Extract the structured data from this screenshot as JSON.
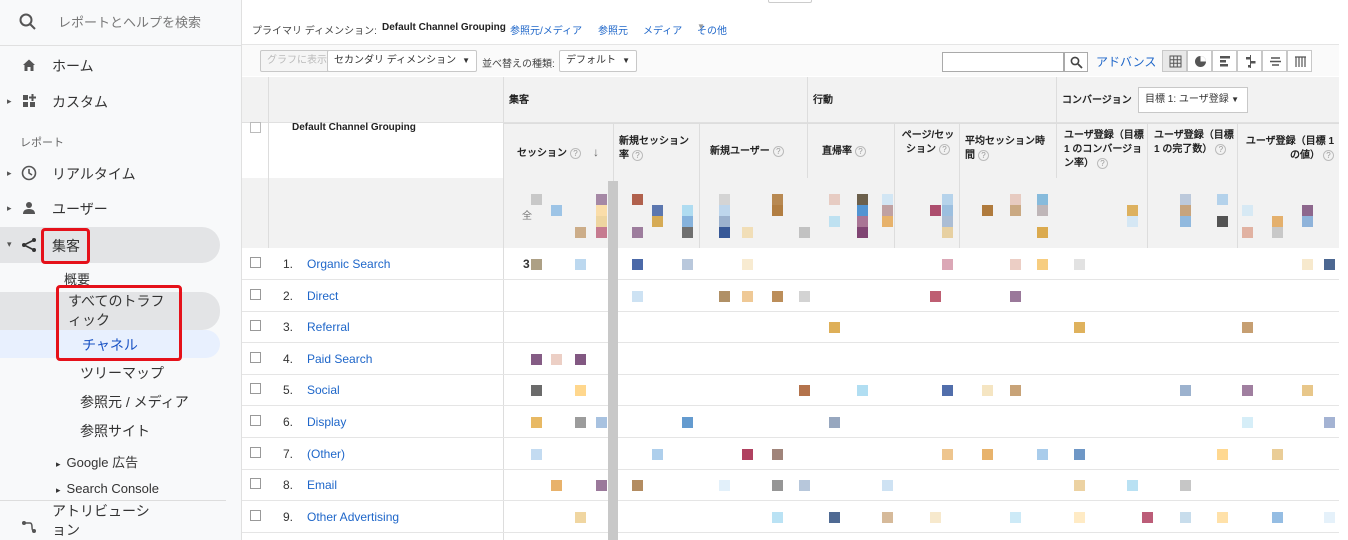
{
  "sidebar": {
    "search_placeholder": "レポートとヘルプを検索",
    "home": "ホーム",
    "custom": "カスタム",
    "reports_section": "レポート",
    "realtime": "リアルタイム",
    "users": "ユーザー",
    "acquisition": "集客",
    "overview": "概要",
    "all_traffic": "すべてのトラフィック",
    "channels": "チャネル",
    "treemap": "ツリーマップ",
    "source_medium": "参照元 / メディア",
    "referrals": "参照サイト",
    "google_ads": "Google 広告",
    "search_console": "Search Console",
    "attribution": "アトリビューション"
  },
  "dimension_bar": {
    "label": "プライマリ ディメンション:",
    "active": "Default Channel Grouping",
    "links": [
      "参照元/メディア",
      "参照元",
      "メディア",
      "その他"
    ]
  },
  "toolbar": {
    "plot_button": "グラフに表示",
    "secondary_dimension": "セカンダリ ディメンション",
    "sort_label": "並べ替えの種類:",
    "sort_value": "デフォルト",
    "advanced": "アドバンス",
    "search_value": ""
  },
  "table": {
    "dimension_header": "Default Channel Grouping",
    "groups": {
      "acquisition": "集客",
      "behavior": "行動",
      "conversions": "コンバージョン",
      "goal_select": "目標 1: ユーザ登録"
    },
    "columns": {
      "sessions": "セッション",
      "new_session_rate": "新規セッション率",
      "new_users": "新規ユーザー",
      "bounce_rate": "直帰率",
      "pages_per_session": "ページ/セッション",
      "avg_session_duration": "平均セッション時間",
      "goal_conv_rate": "ユーザ登録（目標 1 のコンバージョン率）",
      "goal_completions": "ユーザ登録（目標 1 の完了数）",
      "goal_value": "ユーザ登録（目標 1 の値）"
    },
    "totals_glyph": "全",
    "first_row_partial": "3",
    "rows": [
      {
        "num": "1.",
        "name": "Organic Search"
      },
      {
        "num": "2.",
        "name": "Direct"
      },
      {
        "num": "3.",
        "name": "Referral"
      },
      {
        "num": "4.",
        "name": "Paid Search"
      },
      {
        "num": "5.",
        "name": "Social"
      },
      {
        "num": "6.",
        "name": "Display"
      },
      {
        "num": "7.",
        "name": "(Other)"
      },
      {
        "num": "8.",
        "name": "Email"
      },
      {
        "num": "9.",
        "name": "Other Advertising"
      }
    ]
  },
  "colors": {
    "accent": "#1e66c9",
    "highlight": "#e5111a",
    "active_nav": "#e8f0fe"
  }
}
